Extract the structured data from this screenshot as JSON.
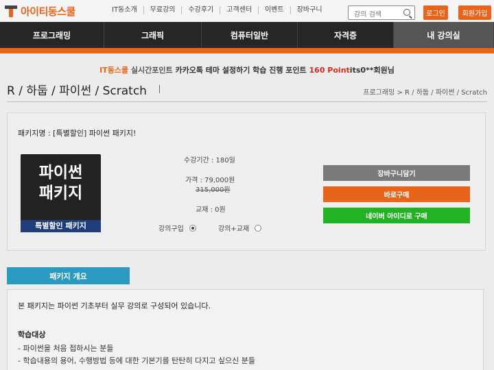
{
  "header": {
    "logo_text": "아이티동스쿨",
    "nav": [
      "IT동소개",
      "무료강의",
      "수강후기",
      "고객센터",
      "이벤트",
      "장바구니"
    ],
    "search_placeholder": "강의 검색",
    "login_label": "로그인",
    "join_label": "회원가입"
  },
  "main_nav": [
    "프로그래밍",
    "그래픽",
    "컴퓨터일반",
    "자격증",
    "내 강의실"
  ],
  "promo": {
    "brand": "IT동스쿨",
    "label": "실시간포인트",
    "message": "카카오톡 테마 설정하기 학습 진행 포인트",
    "points": "160 Point",
    "user": "its0**회원님"
  },
  "page": {
    "title": "R / 하둡 / 파이썬 / Scratch",
    "breadcrumb": "프로그래밍 > R / 하둡 / 파이썬 / Scratch"
  },
  "package": {
    "name": "패키지명 : [특별할인] 파이썬 패키지!",
    "thumb_title": "파이썬\n패키지",
    "thumb_banner": "특별할인 패키지",
    "period": "수강기간 : 180일",
    "price": "가격 : 79,000원",
    "original_price": "315,000원",
    "textbook": "교재 : 0원",
    "options": [
      {
        "label": "강의구입",
        "selected": true
      },
      {
        "label": "강의+교재",
        "selected": false
      }
    ],
    "actions": {
      "cart": "장바구니담기",
      "buy": "바로구매",
      "naver": "네이버 아이디로 구매"
    }
  },
  "overview": {
    "tab_label": "패키지 개요",
    "intro": "본 패키지는 파이썬 기초부터 실무 강의로 구성되어 있습니다.",
    "target_title": "학습대상",
    "targets": [
      "- 파이썬을 처음 접하시는 분들",
      "- 학습내용의 용어, 수행방법 등에 대한 기본기를 탄탄히 다지고 싶으신 분들"
    ]
  },
  "colors": {
    "accent": "#e8641b",
    "nav_bg": "#262626",
    "tab_blue": "#2a9ac0",
    "naver_green": "#23b223"
  }
}
